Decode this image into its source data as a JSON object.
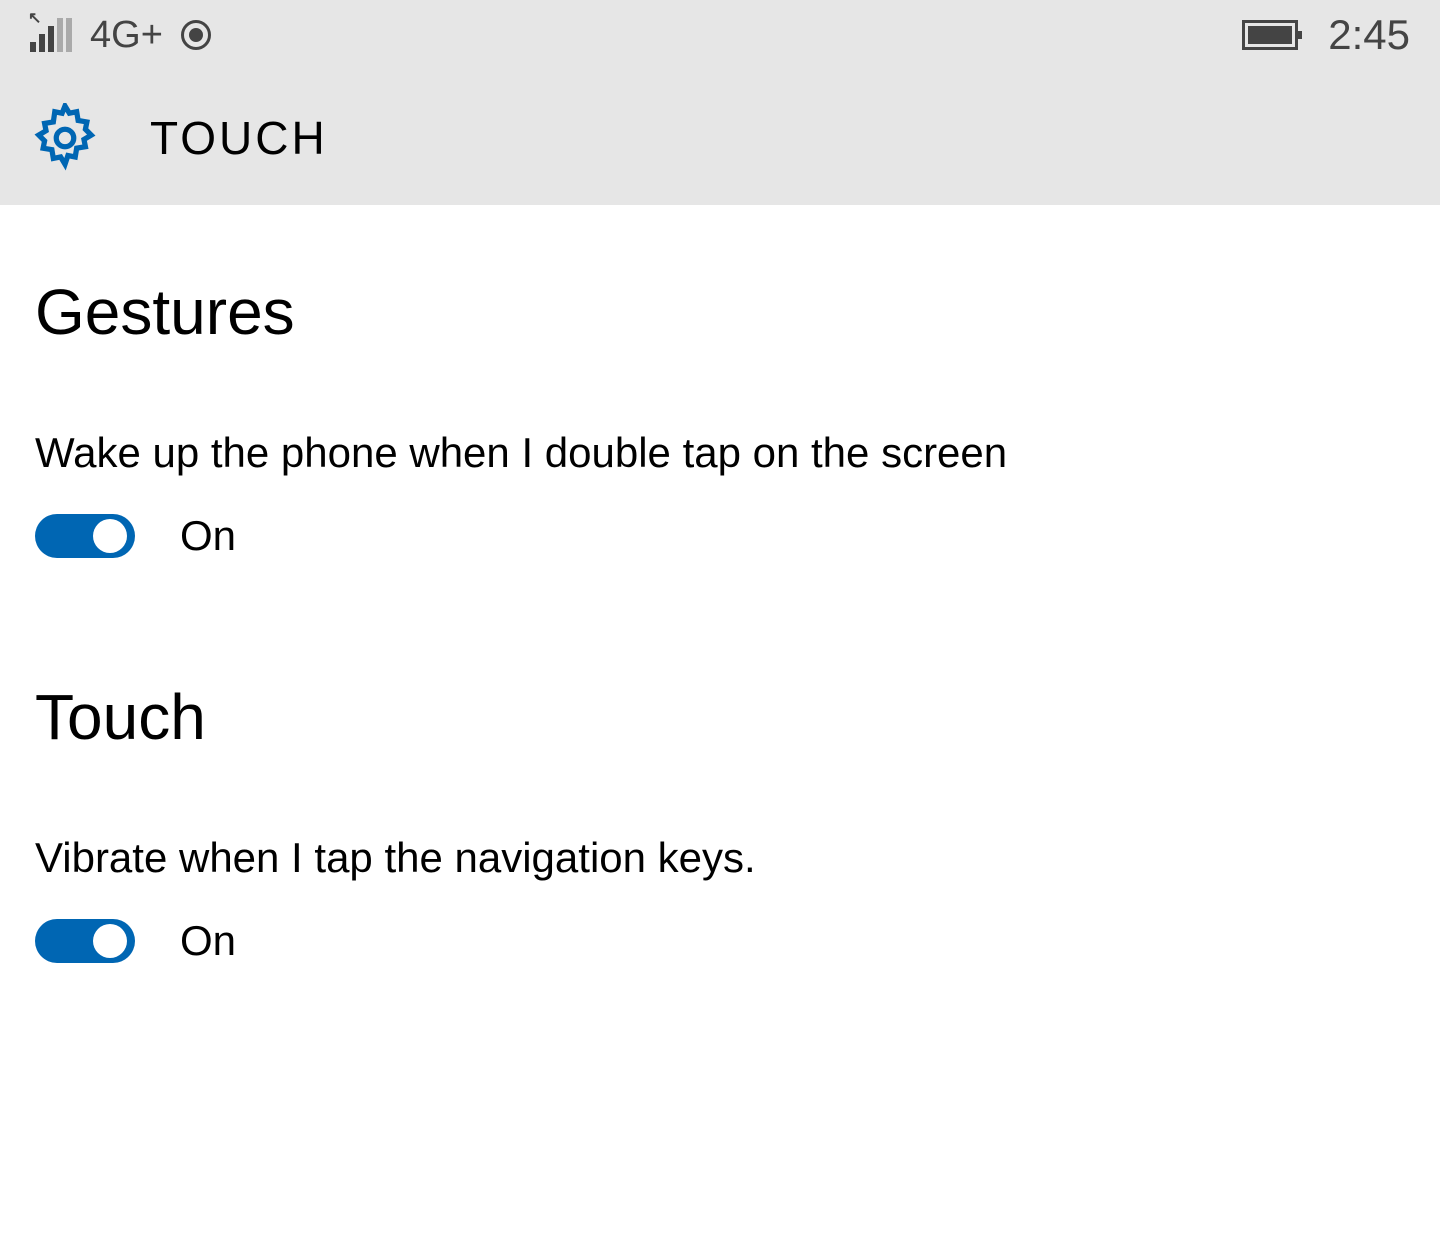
{
  "status_bar": {
    "network_label": "4G+",
    "clock": "2:45"
  },
  "header": {
    "title": "TOUCH"
  },
  "sections": {
    "gestures": {
      "heading": "Gestures",
      "wake_on_tap": {
        "label": "Wake up the phone when I double tap on the screen",
        "state": "On"
      }
    },
    "touch": {
      "heading": "Touch",
      "vibrate_nav": {
        "label": "Vibrate when I tap the navigation keys.",
        "state": "On"
      }
    }
  },
  "colors": {
    "accent": "#0066b3",
    "header_bg": "#e6e6e6"
  }
}
